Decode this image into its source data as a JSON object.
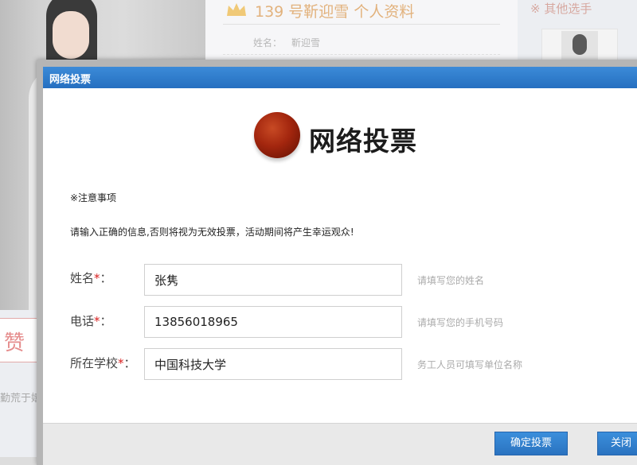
{
  "background": {
    "contestant_title": "139 号靳迎雪 个人资料",
    "name_label": "姓名：",
    "name_value": "靳迎雪",
    "side_title": "※ 其他选手",
    "like_label": "赞",
    "note_fragment": "勤荒于嬉"
  },
  "dialog": {
    "title": "网络投票",
    "heading": "网络投票",
    "notice_title": "※注意事项",
    "notice_text": "请输入正确的信息,否则将视为无效投票，活动期间将产生幸运观众!",
    "fields": [
      {
        "label": "姓名",
        "required_mark": "*",
        "colon": "：",
        "value": "张隽",
        "hint": "请填写您的姓名"
      },
      {
        "label": "电话",
        "required_mark": "*",
        "colon": "：",
        "value": "13856018965",
        "hint": "请填写您的手机号码"
      },
      {
        "label": "所在学校",
        "required_mark": "*",
        "colon": "：",
        "value": "中国科技大学",
        "hint": "务工人员可填写单位名称"
      }
    ],
    "buttons": {
      "confirm": "确定投票",
      "close": "关闭"
    }
  },
  "colors": {
    "titlebar": "#2a76c6",
    "button": "#3184d2",
    "required": "#d81e1e",
    "background_title": "#e2b27d"
  }
}
